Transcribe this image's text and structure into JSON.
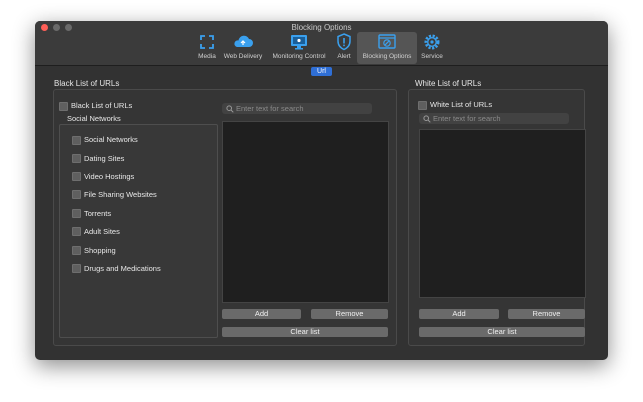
{
  "window": {
    "title": "Blocking Options"
  },
  "toolbar": {
    "items": [
      {
        "label": "Media",
        "icon": "media-icon"
      },
      {
        "label": "Web Delivery",
        "icon": "cloud-icon"
      },
      {
        "label": "Monitoring Control",
        "icon": "monitor-icon"
      },
      {
        "label": "Alert",
        "icon": "alert-shield-icon"
      },
      {
        "label": "Blocking Options",
        "icon": "blocking-icon"
      },
      {
        "label": "Service",
        "icon": "gear-icon"
      }
    ],
    "selected": "Blocking Options"
  },
  "segment": {
    "label": "Url"
  },
  "blacklist": {
    "section_title": "Black List of URLs",
    "checkbox_label": "Black List of URLs",
    "subgroup_title": "Social Networks",
    "categories": [
      "Social Networks",
      "Dating Sites",
      "Video Hostings",
      "File Sharing Websites",
      "Torrents",
      "Adult Sites",
      "Shopping",
      "Drugs and Medications"
    ],
    "search_placeholder": "Enter text for search",
    "add_label": "Add",
    "remove_label": "Remove",
    "clear_label": "Clear list"
  },
  "whitelist": {
    "section_title": "White List of URLs",
    "checkbox_label": "White List of URLs",
    "search_placeholder": "Enter text for search",
    "add_label": "Add",
    "remove_label": "Remove",
    "clear_label": "Clear list"
  },
  "colors": {
    "accent": "#2f6fd6",
    "icon_blue": "#3aa0ee",
    "window_bg": "#323232"
  }
}
